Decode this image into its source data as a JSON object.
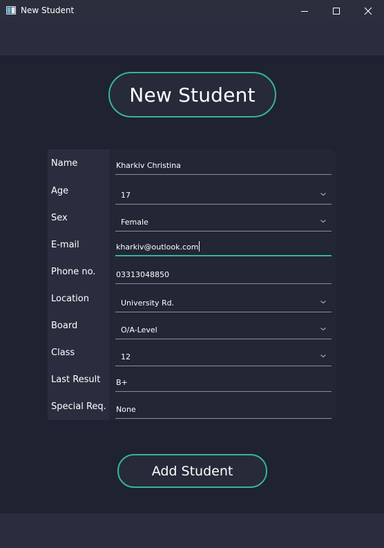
{
  "window": {
    "title": "New Student"
  },
  "header": {
    "title": "New Student"
  },
  "form": {
    "fields": [
      {
        "label": "Name",
        "value": "Kharkiv Christina",
        "type": "text"
      },
      {
        "label": "Age",
        "value": "17",
        "type": "combo"
      },
      {
        "label": "Sex",
        "value": "Female",
        "type": "combo"
      },
      {
        "label": "E-mail",
        "value": "kharkiv@outlook.com",
        "type": "text",
        "focused": true
      },
      {
        "label": "Phone no.",
        "value": "03313048850",
        "type": "text"
      },
      {
        "label": "Location",
        "value": "University Rd.",
        "type": "combo"
      },
      {
        "label": "Board",
        "value": "O/A-Level",
        "type": "combo"
      },
      {
        "label": "Class",
        "value": "12",
        "type": "combo"
      },
      {
        "label": "Last Result",
        "value": "B+",
        "type": "text"
      },
      {
        "label": "Special Req.",
        "value": "None",
        "type": "text"
      }
    ]
  },
  "actions": {
    "add_label": "Add Student"
  },
  "colors": {
    "accent": "#35b59c",
    "background": "#1f2230",
    "titlebar": "#2b2e3c",
    "panel": "#232635",
    "label_column": "#2a2d3e",
    "underline": "#8b8e99",
    "text": "#ffffff"
  }
}
